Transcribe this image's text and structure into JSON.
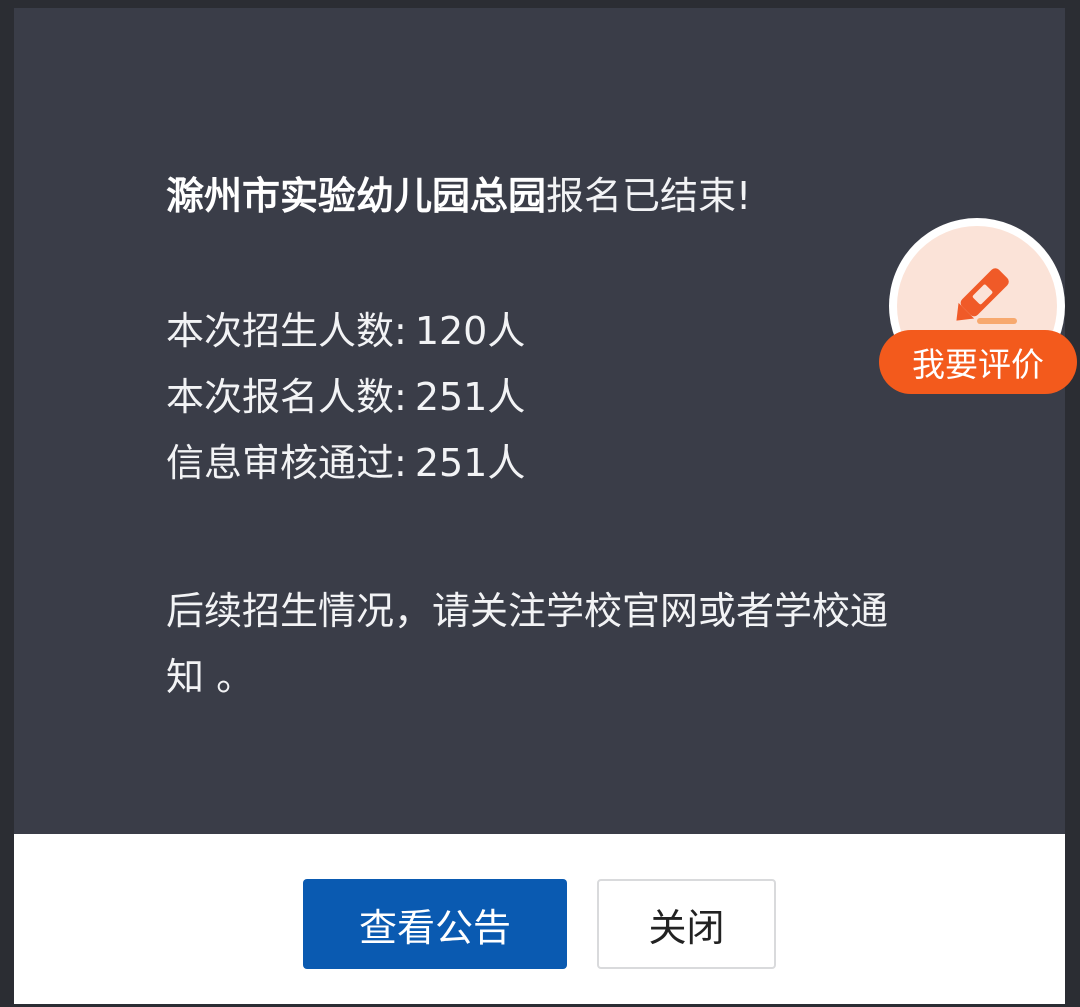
{
  "dialog": {
    "school_name": "滁州市实验幼儿园总园",
    "status_suffix": "报名已结束!",
    "stats": [
      {
        "label": "本次招生人数:",
        "value": "120人"
      },
      {
        "label": "本次报名人数:",
        "value": "251人"
      },
      {
        "label": "信息审核通过:",
        "value": "251人"
      }
    ],
    "followup_text": "后续招生情况，请关注学校官网或者学校通知 。",
    "view_notice_button": "查看公告",
    "close_button": "关闭"
  },
  "rate_widget": {
    "label": "我要评价",
    "icon": "pencil-icon"
  },
  "colors": {
    "dialog_bg": "#3a3d48",
    "primary_button": "#0a5ab1",
    "rate_pill": "#f35a1c",
    "pencil": "#f05a28"
  }
}
